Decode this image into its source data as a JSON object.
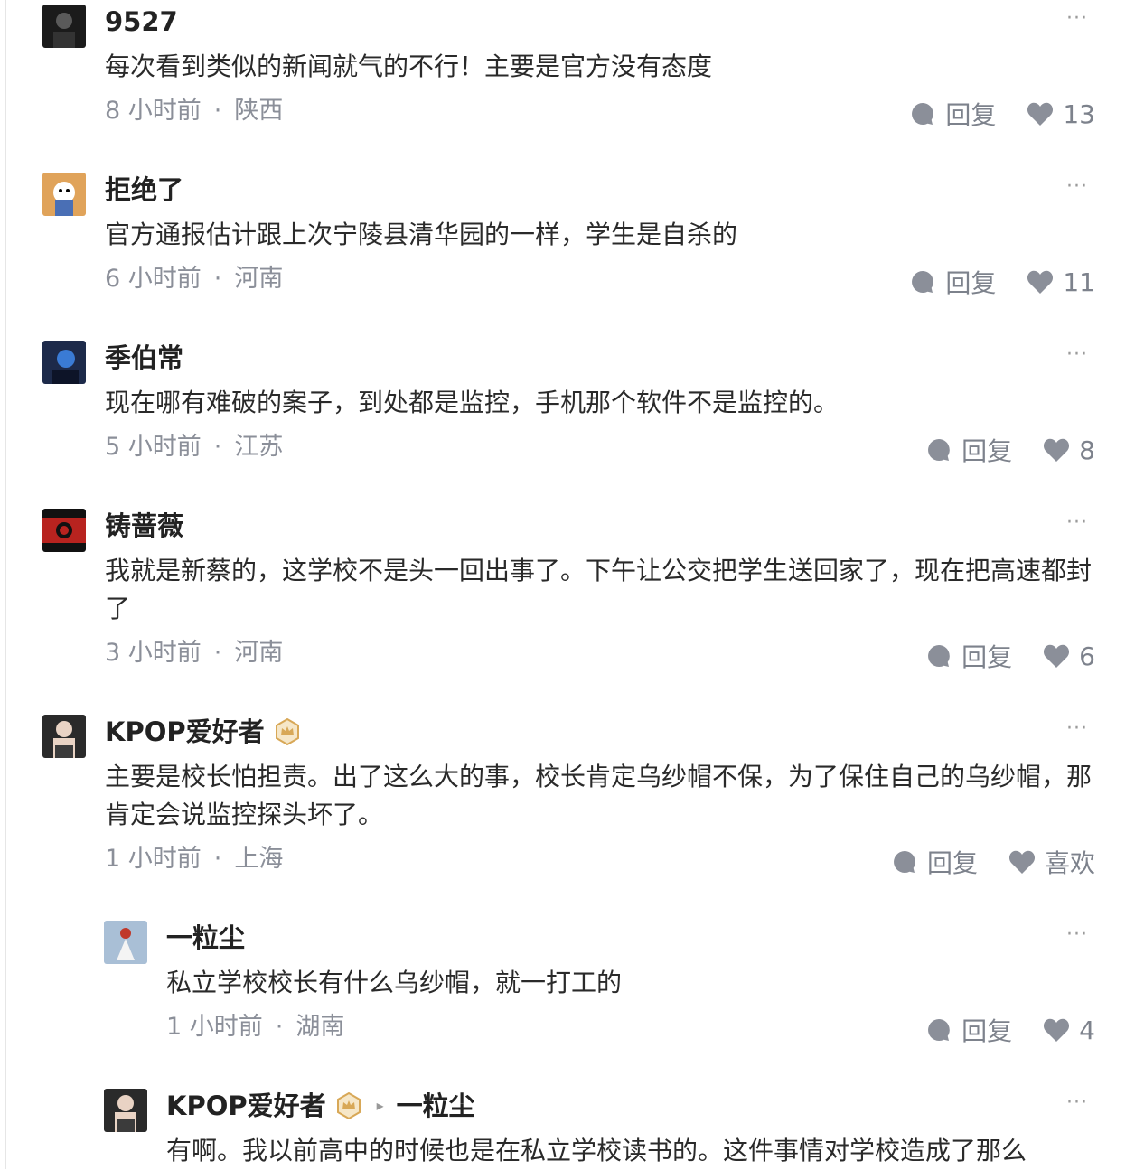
{
  "comments": [
    {
      "user": "9527",
      "text": "每次看到类似的新闻就气的不行！主要是官方没有态度",
      "time": "8 小时前",
      "loc": "陕西",
      "reply": "回复",
      "likes": "13",
      "more": "···"
    },
    {
      "user": "拒绝了",
      "text": "官方通报估计跟上次宁陵县清华园的一样，学生是自杀的",
      "time": "6 小时前",
      "loc": "河南",
      "reply": "回复",
      "likes": "11",
      "more": "···"
    },
    {
      "user": "季伯常",
      "text": "现在哪有难破的案子，到处都是监控，手机那个软件不是监控的。",
      "time": "5 小时前",
      "loc": "江苏",
      "reply": "回复",
      "likes": "8",
      "more": "···"
    },
    {
      "user": "铸蔷薇",
      "text": "我就是新蔡的，这学校不是头一回出事了。下午让公交把学生送回家了，现在把高速都封了",
      "time": "3 小时前",
      "loc": "河南",
      "reply": "回复",
      "likes": "6",
      "more": "···"
    },
    {
      "user": "KPOP爱好者",
      "text": "主要是校长怕担责。出了这么大的事，校长肯定乌纱帽不保，为了保住自己的乌纱帽，那肯定会说监控探头坏了。",
      "time": "1 小时前",
      "loc": "上海",
      "reply": "回复",
      "likes": "喜欢",
      "more": "···"
    }
  ],
  "replies": [
    {
      "user": "一粒尘",
      "text": "私立学校校长有什么乌纱帽，就一打工的",
      "time": "1 小时前",
      "loc": "湖南",
      "reply": "回复",
      "likes": "4",
      "more": "···"
    },
    {
      "user": "KPOP爱好者",
      "reply_to": "一粒尘",
      "text": "有啊。我以前高中的时候也是在私立学校读书的。这件事情对学校造成了那么",
      "more": "···"
    }
  ],
  "colors": {
    "accent_text": "#222222",
    "meta": "#8b8f99",
    "icon": "#8b8f99",
    "badge": "#d8a857"
  },
  "icons": [
    "comment-icon",
    "heart-icon",
    "crown-badge-icon",
    "more-icon",
    "reply-arrow-icon"
  ]
}
